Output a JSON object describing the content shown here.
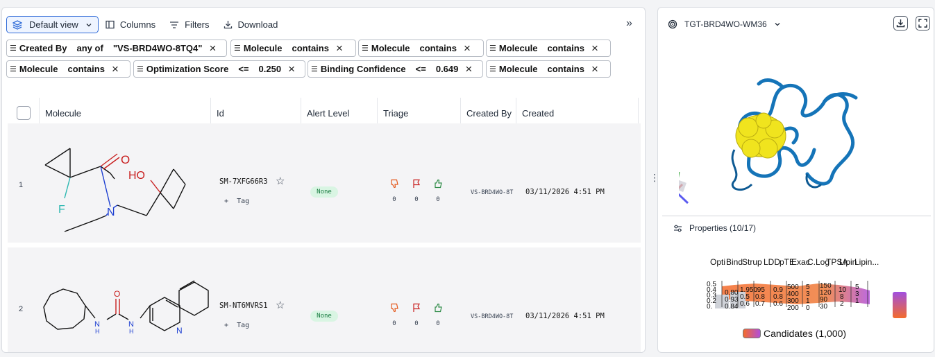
{
  "toolbar": {
    "view_label": "Default view",
    "columns_label": "Columns",
    "filters_label": "Filters",
    "download_label": "Download"
  },
  "filters": [
    {
      "field": "Created By",
      "op": "any of",
      "value": "\"VS-BRD4WO-8TQ4\""
    },
    {
      "field": "Molecule",
      "op": "contains",
      "value": ""
    },
    {
      "field": "Molecule",
      "op": "contains",
      "value": ""
    },
    {
      "field": "Molecule",
      "op": "contains",
      "value": ""
    },
    {
      "field": "Molecule",
      "op": "contains",
      "value": ""
    },
    {
      "field": "Optimization Score",
      "op": "<=",
      "value": "0.250"
    },
    {
      "field": "Binding Confidence",
      "op": "<=",
      "value": "0.649"
    },
    {
      "field": "Molecule",
      "op": "contains",
      "value": ""
    }
  ],
  "columns": [
    "Molecule",
    "Id",
    "Alert Level",
    "Triage",
    "Created By",
    "Created"
  ],
  "rows": [
    {
      "num": "1",
      "id": "SM-7XFG66R3",
      "tag": "Tag",
      "alert": "None",
      "down": "0",
      "flag": "0",
      "up": "0",
      "created_by": "VS-BRD4WO-8T",
      "created": "03/11/2026 4:51 PM"
    },
    {
      "num": "2",
      "id": "SM-NT6MVRS1",
      "tag": "Tag",
      "alert": "None",
      "down": "0",
      "flag": "0",
      "up": "0",
      "created_by": "VS-BRD4WO-8T",
      "created": "03/11/2026 4:51 PM"
    }
  ],
  "target": {
    "name": "TGT-BRD4WO-WM36"
  },
  "properties": {
    "label": "Properties (10/17)",
    "axes": [
      "Opti",
      "Bind",
      "Strup",
      "LDD",
      "pTE",
      "Exac",
      "C.Log",
      "TPSA",
      "Lipin",
      "Lipin..."
    ],
    "legend": "Candidates (1,000)"
  },
  "colors": {
    "accent": "#2f6bd8",
    "badge": "#d9f5e3",
    "down": "#e4571a",
    "flag": "#c81e1e",
    "up": "#2e8b47"
  }
}
